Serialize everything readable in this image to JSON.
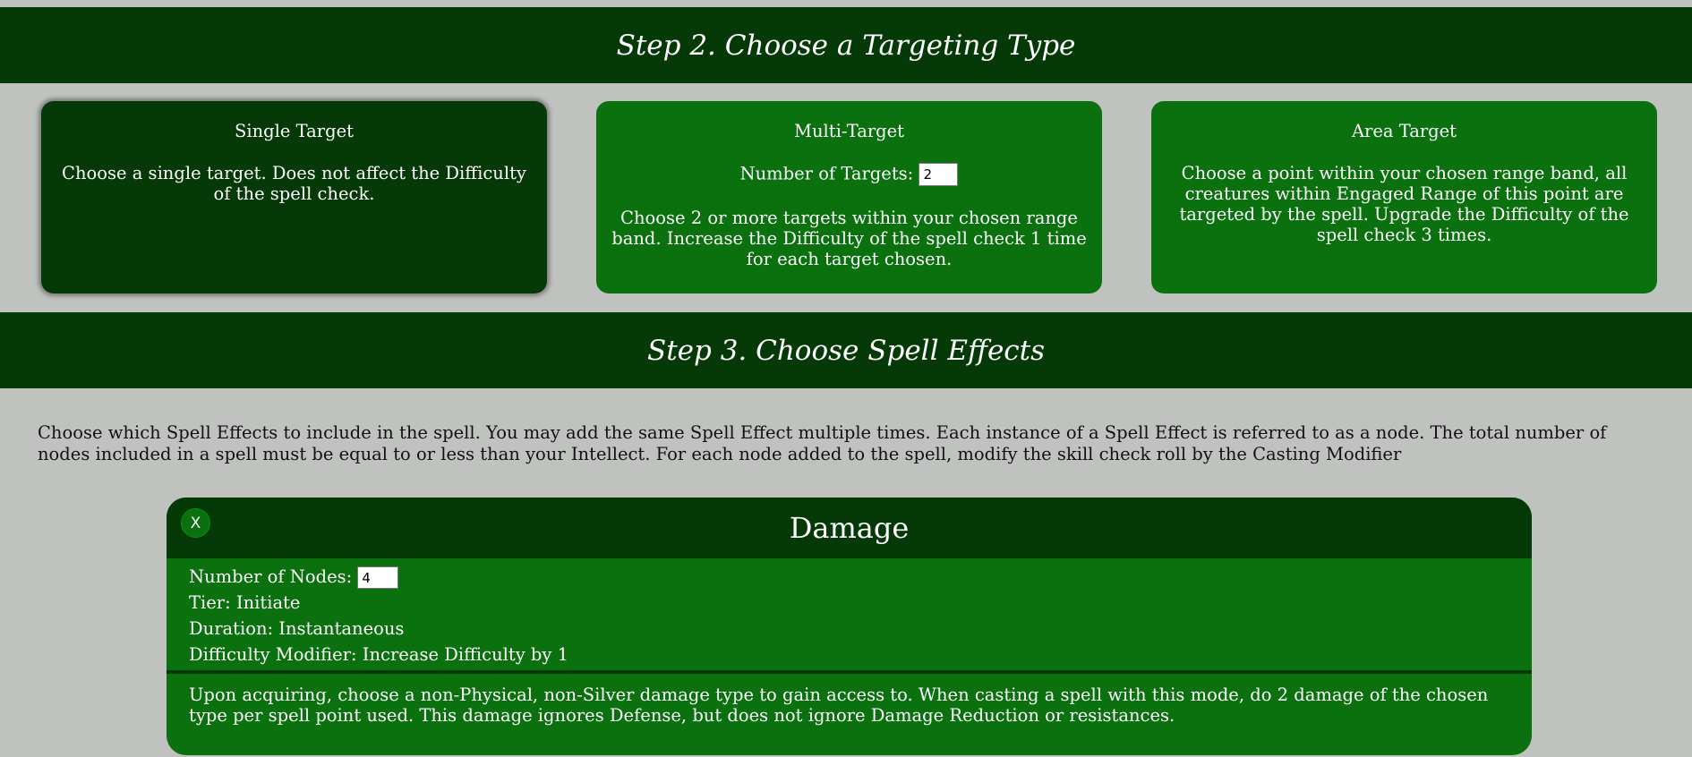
{
  "step2": {
    "title": "Step 2. Choose a Targeting Type",
    "cards": [
      {
        "title": "Single Target",
        "description": "Choose a single target. Does not affect the Difficulty of the spell check.",
        "selected": true
      },
      {
        "title": "Multi-Target",
        "input_label": "Number of Targets:",
        "input_value": "2",
        "description": "Choose 2 or more targets within your chosen range band. Increase the Difficulty of the spell check 1 time for each target chosen."
      },
      {
        "title": "Area Target",
        "description": "Choose a point within your chosen range band, all creatures within Engaged Range of this point are targeted by the spell. Upgrade the Difficulty of the spell check 3 times."
      }
    ]
  },
  "step3": {
    "title": "Step 3. Choose Spell Effects",
    "intro": "Choose which Spell Effects to include in the spell. You may add the same Spell Effect multiple times. Each instance of a Spell Effect is referred to as a node. The total number of nodes included in a spell must be equal to or less than your Intellect. For each node added to the spell, modify the skill check roll by the Casting Modifier"
  },
  "effect": {
    "close_label": "X",
    "title": "Damage",
    "nodes_label": "Number of Nodes:",
    "nodes_value": "4",
    "tier": "Tier: Initiate",
    "duration": "Duration: Instantaneous",
    "difficulty": "Difficulty Modifier: Increase Difficulty by 1",
    "description": "Upon acquiring, choose a non-Physical, non-Silver damage type to gain access to. When casting a spell with this mode, do 2 damage of the chosen type per spell point used. This damage ignores Defense, but does not ignore Damage Reduction or resistances."
  },
  "colors": {
    "background": "#bfc2bf",
    "header_dark_green": "#053a08",
    "card_green": "#0b710f"
  }
}
